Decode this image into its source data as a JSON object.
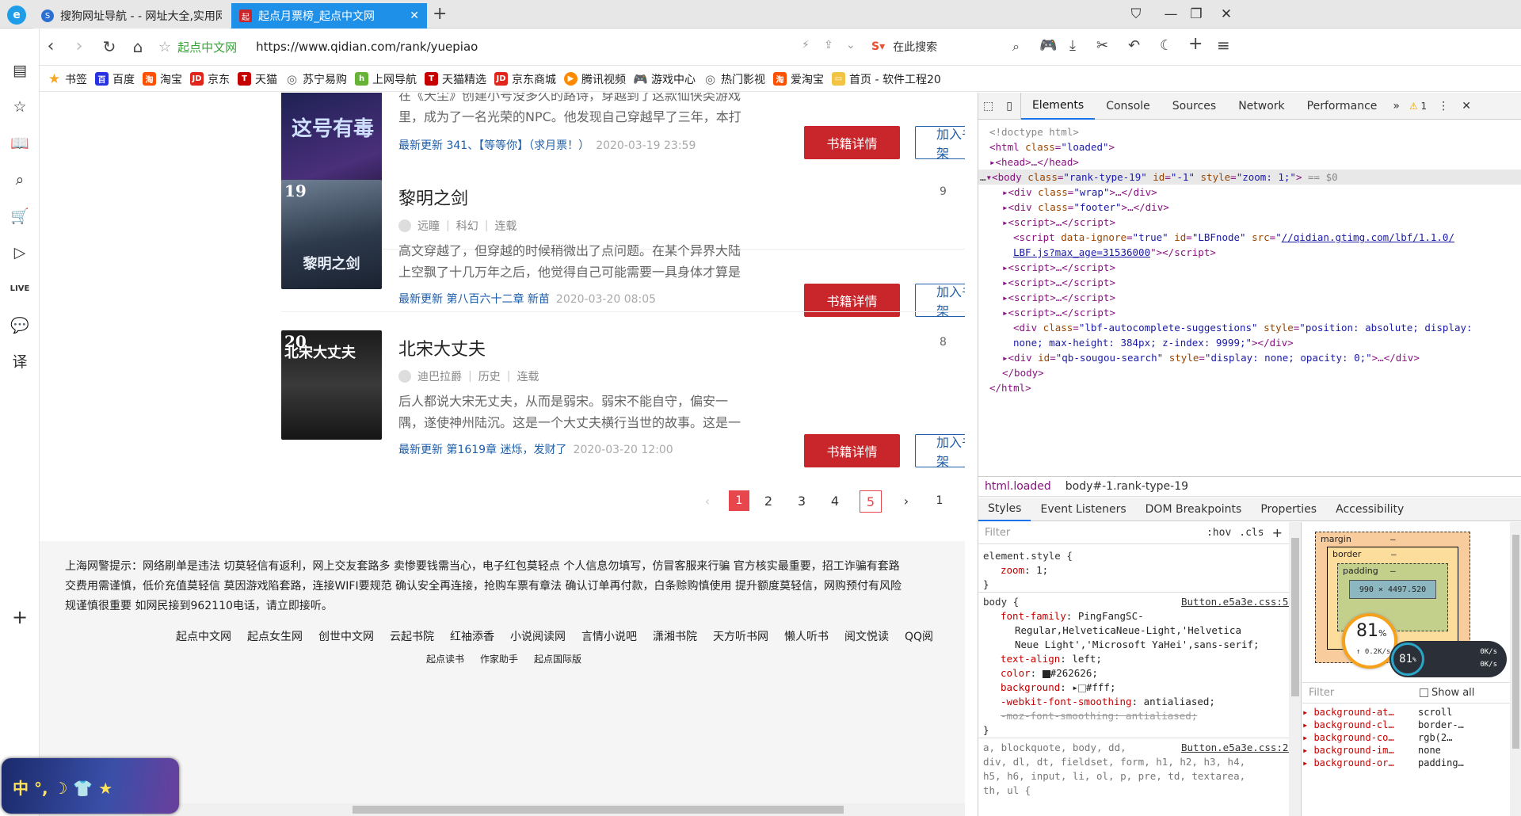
{
  "tabs": [
    {
      "label": "搜狗网址导航 - - 网址大全,实用网址",
      "active": false
    },
    {
      "label": "起点月票榜_起点中文网",
      "active": true
    }
  ],
  "address": {
    "site_label": "起点中文网",
    "url": "https://www.qidian.com/rank/yuepiao",
    "search_placeholder": "在此搜索"
  },
  "bookmarks": [
    "书签",
    "百度",
    "淘宝",
    "京东",
    "天猫",
    "苏宁易购",
    "上网导航",
    "天猫精选",
    "京东商城",
    "腾讯视频",
    "游戏中心",
    "热门影视",
    "爱淘宝",
    "首页 - 软件工程20"
  ],
  "books": [
    {
      "rank": "",
      "title": "",
      "author": "",
      "genre": "",
      "status": "",
      "desc_lines": [
        "在《天尘》创建小号没多久的路诗，穿越到了这款仙侠类游戏",
        "里，成为了一名光荣的NPC。他发现自己穿越早了三年，本打"
      ],
      "update_label": "最新更新",
      "update": "341、【等等你】（求月票！）",
      "time": "2020-03-19 23:59",
      "cover_text": "这号有毒"
    },
    {
      "rank": "19",
      "title": "黎明之剑",
      "author": "远瞳",
      "genre": "科幻",
      "status": "连载",
      "desc_lines": [
        "高文穿越了，但穿越的时候稍微出了点问题。在某个异界大陆",
        "上空飘了十几万年之后，他觉得自己可能需要一具身体才算是"
      ],
      "update_label": "最新更新",
      "update": "第八百六十二章 新苗",
      "time": "2020-03-20 08:05",
      "cover_text": "黎明之剑"
    },
    {
      "rank": "20",
      "title": "北宋大丈夫",
      "author": "迪巴拉爵",
      "genre": "历史",
      "status": "连载",
      "desc_lines": [
        "后人都说大宋无丈夫，从而是弱宋。弱宋不能自守，偏安一",
        "隅，遂使神州陆沉。这是一个大丈夫横行当世的故事。这是一"
      ],
      "update_label": "最新更新",
      "update": "第1619章 迷烁，发财了",
      "time": "2020-03-20 12:00",
      "cover_text": "北宋大丈夫"
    }
  ],
  "buttons": {
    "detail": "书籍详情",
    "add": "加入书架"
  },
  "side_nums": [
    "9",
    "8"
  ],
  "pagination": {
    "prev": "‹",
    "pages": [
      "1",
      "2",
      "3",
      "4",
      "5"
    ],
    "next": "›",
    "jump": "1"
  },
  "footer": {
    "notice": [
      "上海网警提示：网络刷单是违法 切莫轻信有返利，网上交友套路多 卖惨要钱需当心，电子红包莫轻点 个人信息勿填写，仿冒客服来行骗 官方核实最重要，招工诈骗有套路",
      "交费用需谨慎，低价充值莫轻信 莫因游戏陷套路，连接WIFI要规范 确认安全再连接，抢购车票有章法 确认订单再付款，白条赊购慎使用 提升额度莫轻信，网购预付有风险",
      "规谨慎很重要 如网民接到962110电话，请立即接听。"
    ],
    "links": [
      "起点中文网",
      "起点女生网",
      "创世中文网",
      "云起书院",
      "红袖添香",
      "小说阅读网",
      "言情小说吧",
      "潇湘书院",
      "天方听书网",
      "懒人听书",
      "阅文悦读",
      "QQ阅"
    ],
    "links2": [
      "起点读书",
      "作家助手",
      "起点国际版"
    ]
  },
  "widget": {
    "text": "中 °, ☽ 👕 ★"
  },
  "devtools": {
    "tabs": [
      "Elements",
      "Console",
      "Sources",
      "Network",
      "Performance"
    ],
    "warn": "1",
    "crumbs": [
      "html.loaded",
      "body#-1.rank-type-19"
    ],
    "style_tabs": [
      "Styles",
      "Event Listeners",
      "DOM Breakpoints",
      "Properties",
      "Accessibility"
    ],
    "filter": "Filter",
    "hov": ":hov",
    "cls": ".cls",
    "box": {
      "margin": "margin",
      "border": "border",
      "padding": "padding",
      "dash": "–",
      "size": "990 × 4497.520"
    },
    "perf": {
      "pct": "81",
      "unit": "%",
      "speed": "0.2K/s",
      "pct2": "81",
      "up": "0K/s",
      "down": "0K/s"
    },
    "computed_filter": "Filter",
    "show_all": "Show all",
    "computed": [
      [
        "background-at…",
        "scroll"
      ],
      [
        "background-cl…",
        "border-…"
      ],
      [
        "background-co…",
        "rgb(2…"
      ],
      [
        "background-im…",
        "none"
      ],
      [
        "background-or…",
        "padding…"
      ]
    ]
  }
}
